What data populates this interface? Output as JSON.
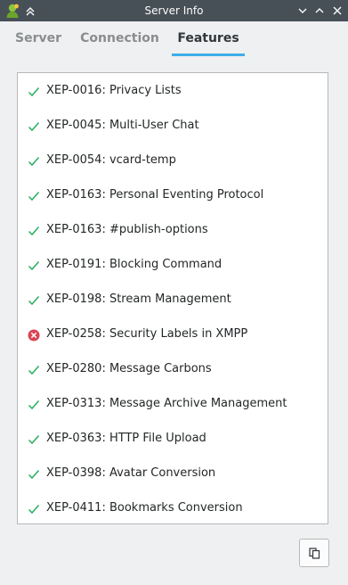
{
  "window": {
    "title": "Server Info",
    "accent_color": "#3daee9",
    "titlebar_color": "#475057"
  },
  "tabs": [
    {
      "label": "Server",
      "active": false
    },
    {
      "label": "Connection",
      "active": false
    },
    {
      "label": "Features",
      "active": true
    }
  ],
  "features": [
    {
      "label": "XEP-0016: Privacy Lists",
      "supported": true
    },
    {
      "label": "XEP-0045: Multi-User Chat",
      "supported": true
    },
    {
      "label": "XEP-0054: vcard-temp",
      "supported": true
    },
    {
      "label": "XEP-0163: Personal Eventing Protocol",
      "supported": true
    },
    {
      "label": "XEP-0163: #publish-options",
      "supported": true
    },
    {
      "label": "XEP-0191: Blocking Command",
      "supported": true
    },
    {
      "label": "XEP-0198: Stream Management",
      "supported": true
    },
    {
      "label": "XEP-0258: Security Labels in XMPP",
      "supported": false
    },
    {
      "label": "XEP-0280: Message Carbons",
      "supported": true
    },
    {
      "label": "XEP-0313: Message Archive Management",
      "supported": true
    },
    {
      "label": "XEP-0363: HTTP File Upload",
      "supported": true
    },
    {
      "label": "XEP-0398: Avatar Conversion",
      "supported": true
    },
    {
      "label": "XEP-0411: Bookmarks Conversion",
      "supported": true
    }
  ],
  "colors": {
    "check": "#27ae60",
    "error": "#da4453"
  },
  "icons": {
    "app": "gajim-app-icon",
    "keep_above": "keep-above-icon",
    "minimize": "minimize-icon",
    "maximize": "maximize-icon",
    "close": "close-icon",
    "supported": "check-icon",
    "unsupported": "error-icon",
    "copy": "copy-icon"
  }
}
